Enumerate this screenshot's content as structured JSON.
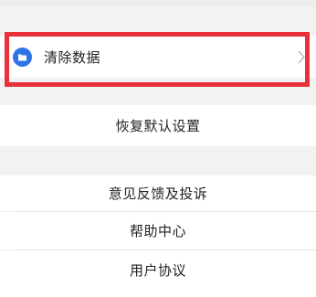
{
  "settings": {
    "clear_data": {
      "icon": "folder-icon",
      "label": "清除数据",
      "chevron": "chevron-right-icon"
    },
    "restore_defaults": {
      "label": "恢复默认设置"
    },
    "feedback": {
      "label": "意见反馈及投诉"
    },
    "help_center": {
      "label": "帮助中心"
    },
    "user_agreement": {
      "label": "用户协议"
    }
  },
  "colors": {
    "highlight": "#e8313a",
    "icon_accent": "#2f74e6",
    "background": "#f2f2f2"
  }
}
